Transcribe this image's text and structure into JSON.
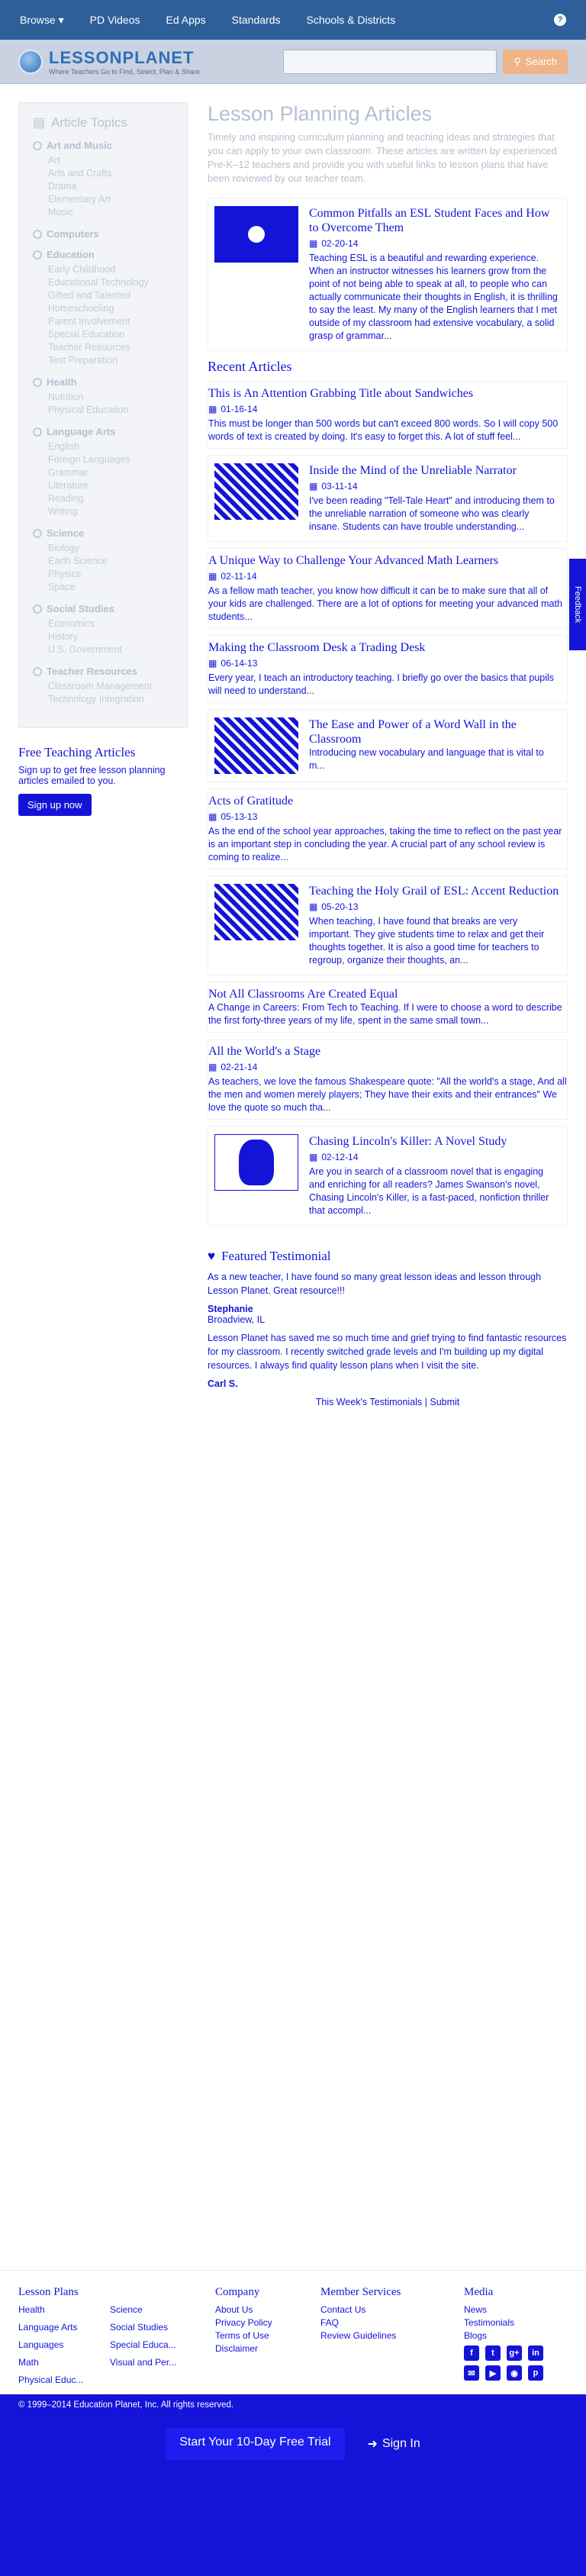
{
  "nav": {
    "browse": "Browse ▾",
    "pd_videos": "PD Videos",
    "ed_apps": "Ed Apps",
    "standards": "Standards",
    "schools": "Schools & Districts"
  },
  "header": {
    "logo_name": "LESSONPLANET",
    "logo_tagline": "Where Teachers Go to Find, Select, Plan & Share",
    "search_placeholder": "",
    "search_label": "Search"
  },
  "sidebar": {
    "title": "Article Topics",
    "categories": [
      {
        "name": "Art and Music",
        "subs": [
          "Art",
          "Arts and Crafts",
          "Drama",
          "Elementary Art",
          "Music"
        ]
      },
      {
        "name": "Computers",
        "subs": []
      },
      {
        "name": "Education",
        "subs": [
          "Early Childhood",
          "Educational Technology",
          "Gifted and Talented",
          "Homeschooling",
          "Parent Involvement",
          "Special Education",
          "Teacher Resources",
          "Test Preparation"
        ]
      },
      {
        "name": "Health",
        "subs": [
          "Nutrition",
          "Physical Education"
        ]
      },
      {
        "name": "Language Arts",
        "subs": [
          "English",
          "Foreign Languages",
          "Grammar",
          "Literature",
          "Reading",
          "Writing"
        ]
      },
      {
        "name": "Science",
        "subs": [
          "Biology",
          "Earth Science",
          "Physics",
          "Space"
        ]
      },
      {
        "name": "Social Studies",
        "subs": [
          "Economics",
          "History",
          "U.S. Government"
        ]
      },
      {
        "name": "Teacher Resources",
        "subs": [
          "Classroom Management",
          "Technology Integration"
        ]
      }
    ]
  },
  "free_articles": {
    "title": "Free Teaching Articles",
    "text": "Sign up to get free lesson planning articles emailed to you.",
    "button": "Sign up now"
  },
  "main": {
    "title": "Lesson Planning Articles",
    "intro": "Timely and inspiring curriculum planning and teaching ideas and strategies that you can apply to your own classroom. These articles are written by experienced Pre-K–12 teachers and provide you with useful links to lesson plans that have been reviewed by our teacher team.",
    "featured": {
      "title": "Common Pitfalls an ESL Student Faces and How to Overcome Them",
      "date": "02-20-14",
      "text": "Teaching ESL is a beautiful and rewarding experience. When an instructor witnesses his learners grow from the point of not being able to speak at all, to people who can actually communicate their thoughts in English, it is thrilling to say the least. My many of the English learners that I met outside of my classroom had extensive vocabulary, a solid grasp of grammar..."
    },
    "recent_title": "Recent Articles",
    "recent": [
      {
        "title": "This is An Attention Grabbing Title about Sandwiches",
        "date": "01-16-14",
        "text": "This must be longer than 500 words but can't exceed 800 words. So I will copy 500 words of text is created by doing. It's easy to forget this. A lot of stuff feel..."
      },
      {
        "title": "Inside the Mind of the Unreliable Narrator",
        "date": "03-11-14",
        "text": "I've been reading \"Tell-Tale Heart\" and introducing them to the unreliable narration of someone who was clearly insane. Students can have trouble understanding..."
      },
      {
        "title": "A Unique Way to Challenge Your Advanced Math Learners",
        "date": "02-11-14",
        "text": "As a fellow math teacher, you know how difficult it can be to make sure that all of your kids are challenged. There are a lot of options for meeting your advanced math students..."
      },
      {
        "title": "Making the Classroom Desk a Trading Desk",
        "date": "06-14-13",
        "text": "Every year, I teach an introductory teaching. I briefly go over the basics that pupils will need to understand..."
      },
      {
        "title": "The Ease and Power of a Word Wall in the Classroom",
        "date": "",
        "text": "Introducing new vocabulary and language that is vital to m..."
      },
      {
        "title": "Acts of Gratitude",
        "date": "05-13-13",
        "text": "As the end of the school year approaches, taking the time to reflect on the past year is an important step in concluding the year. A crucial part of any school review is coming to realize..."
      },
      {
        "title": "Teaching the Holy Grail of ESL: Accent Reduction",
        "date": "05-20-13",
        "text": "When teaching, I have found that breaks are very important. They give students time to relax and get their thoughts together. It is also a good time for teachers to regroup, organize their thoughts, an..."
      },
      {
        "title": "Not All Classrooms Are Created Equal",
        "date": "",
        "text": "A Change in Careers: From Tech to Teaching. If I were to choose a word to describe the first forty-three years of my life, spent in the same small town..."
      },
      {
        "title": "All the World's a Stage",
        "date": "02-21-14",
        "text": "As teachers, we love the famous Shakespeare quote: \"All the world's a stage, And all the men and women merely players; They have their exits and their entrances\" We love the quote so much tha..."
      },
      {
        "title": "Chasing Lincoln's Killer: A Novel Study",
        "date": "02-12-14",
        "text": "Are you in search of a classroom novel that is engaging and enriching for all readers? James Swanson's novel, Chasing Lincoln's Killer, is a fast-paced, nonfiction thriller that accompl..."
      }
    ]
  },
  "testimonial": {
    "title": "Featured Testimonial",
    "text1": "As a new teacher, I have found so many great lesson ideas and lesson through Lesson Planet. Great resource!!!",
    "author1": "Stephanie",
    "loc1": "Broadview, IL",
    "text2": "Lesson Planet has saved me so much time and grief trying to find fantastic resources for my classroom. I recently switched grade levels and I'm building up my digital resources. I always find quality lesson plans when I visit the site.",
    "author2": "Carl S.",
    "links": "This Week's Testimonials | Submit"
  },
  "footer": {
    "lesson_plans_title": "Lesson Plans",
    "lesson_plans": [
      "Health",
      "Science",
      "Language Arts",
      "Social Studies",
      "Languages",
      "Special Educa...",
      "Math",
      "Visual and Per...",
      "Physical Educ..."
    ],
    "company_title": "Company",
    "company": [
      "About Us",
      "Privacy Policy",
      "Terms of Use",
      "Disclaimer"
    ],
    "member_title": "Member Services",
    "member": [
      "Contact Us",
      "FAQ",
      "Review Guidelines"
    ],
    "media_title": "Media",
    "media": [
      "News",
      "Testimonials",
      "Blogs"
    ],
    "copyright": "© 1999–2014 Education Planet, Inc. All rights reserved.",
    "cta_trial": "Start Your 10-Day Free Trial",
    "cta_signin": "Sign In",
    "feedback": "Feedback"
  }
}
